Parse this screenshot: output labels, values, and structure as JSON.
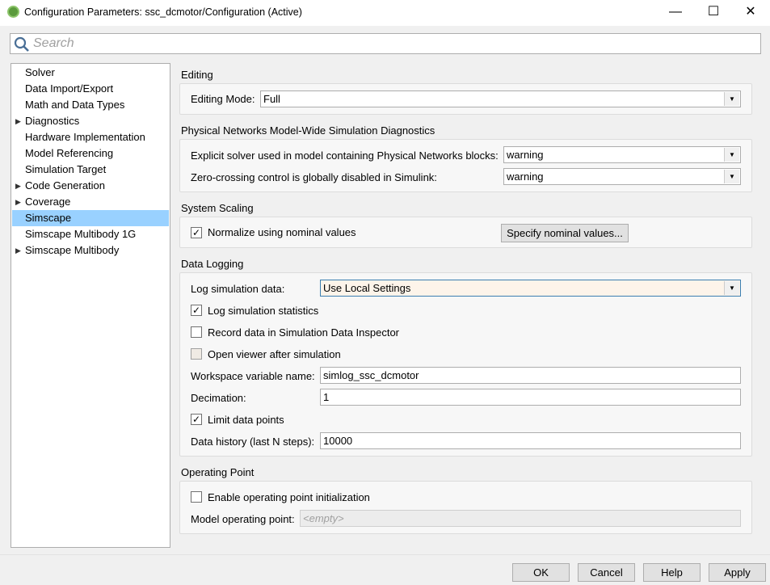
{
  "window": {
    "title": "Configuration Parameters: ssc_dcmotor/Configuration (Active)",
    "minimize": "—",
    "maximize": "☐",
    "close": "✕"
  },
  "search": {
    "placeholder": "Search"
  },
  "tree": [
    {
      "label": "Solver",
      "expandable": false
    },
    {
      "label": "Data Import/Export",
      "expandable": false
    },
    {
      "label": "Math and Data Types",
      "expandable": false
    },
    {
      "label": "Diagnostics",
      "expandable": true
    },
    {
      "label": "Hardware Implementation",
      "expandable": false
    },
    {
      "label": "Model Referencing",
      "expandable": false
    },
    {
      "label": "Simulation Target",
      "expandable": false
    },
    {
      "label": "Code Generation",
      "expandable": true
    },
    {
      "label": "Coverage",
      "expandable": true
    },
    {
      "label": "Simscape",
      "expandable": false,
      "selected": true
    },
    {
      "label": "Simscape Multibody 1G",
      "expandable": false
    },
    {
      "label": "Simscape Multibody",
      "expandable": true
    }
  ],
  "editing": {
    "heading": "Editing",
    "mode_label": "Editing Mode:",
    "mode_value": "Full"
  },
  "diagnostics": {
    "heading": "Physical Networks Model-Wide Simulation Diagnostics",
    "explicit_label": "Explicit solver used in model containing Physical Networks blocks:",
    "explicit_value": "warning",
    "zc_label": "Zero-crossing control is globally disabled in Simulink:",
    "zc_value": "warning"
  },
  "scaling": {
    "heading": "System Scaling",
    "normalize_label": "Normalize using nominal values",
    "normalize_checked": true,
    "specify_button": "Specify nominal values..."
  },
  "logging": {
    "heading": "Data Logging",
    "log_label": "Log simulation data:",
    "log_value": "Use Local Settings",
    "stats_label": "Log simulation statistics",
    "stats_checked": true,
    "sdi_label": "Record data in Simulation Data Inspector",
    "sdi_checked": false,
    "viewer_label": "Open viewer after simulation",
    "viewer_checked": false,
    "ws_label": "Workspace variable name:",
    "ws_value": "simlog_ssc_dcmotor",
    "dec_label": "Decimation:",
    "dec_value": "1",
    "limit_label": "Limit data points",
    "limit_checked": true,
    "hist_label": "Data history (last N steps):",
    "hist_value": "10000"
  },
  "op": {
    "heading": "Operating Point",
    "enable_label": "Enable operating point initialization",
    "enable_checked": false,
    "model_label": "Model operating point:",
    "model_placeholder": "<empty>"
  },
  "footer": {
    "ok": "OK",
    "cancel": "Cancel",
    "help": "Help",
    "apply": "Apply"
  },
  "colors": {
    "selection": "#99d1ff",
    "log_dropdown_bg": "#fdf4ea",
    "log_dropdown_border": "#3c7fb1"
  }
}
